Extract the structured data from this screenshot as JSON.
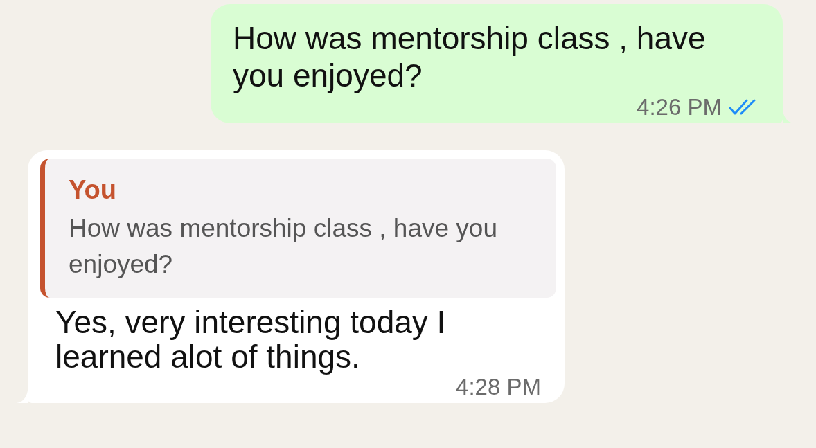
{
  "messages": [
    {
      "kind": "outgoing",
      "text": "How was mentorship class , have you enjoyed?",
      "time": "4:26 PM",
      "read": true
    },
    {
      "kind": "incoming",
      "reply": {
        "author": "You",
        "text": "How was mentorship class , have you enjoyed?"
      },
      "text": "Yes, very interesting today I learned alot of things.",
      "time": "4:28 PM"
    }
  ]
}
